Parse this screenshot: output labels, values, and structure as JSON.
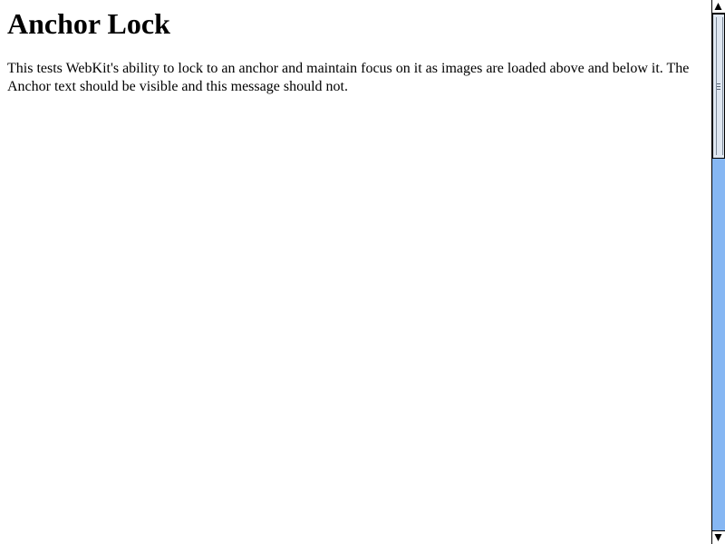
{
  "page": {
    "title": "Anchor Lock",
    "description": "This tests WebKit's ability to lock to an anchor and maintain focus on it as images are loaded above and below it. The Anchor text should be visible and this message should not."
  },
  "scrollbar": {
    "thumb_position": 0,
    "thumb_fraction": 0.28,
    "colors": {
      "track": "#86b7f3",
      "thumb": "#dfe7f1",
      "buttons": "#ffffff"
    },
    "icons": {
      "up": "up-arrow-icon",
      "down": "down-arrow-icon"
    }
  }
}
